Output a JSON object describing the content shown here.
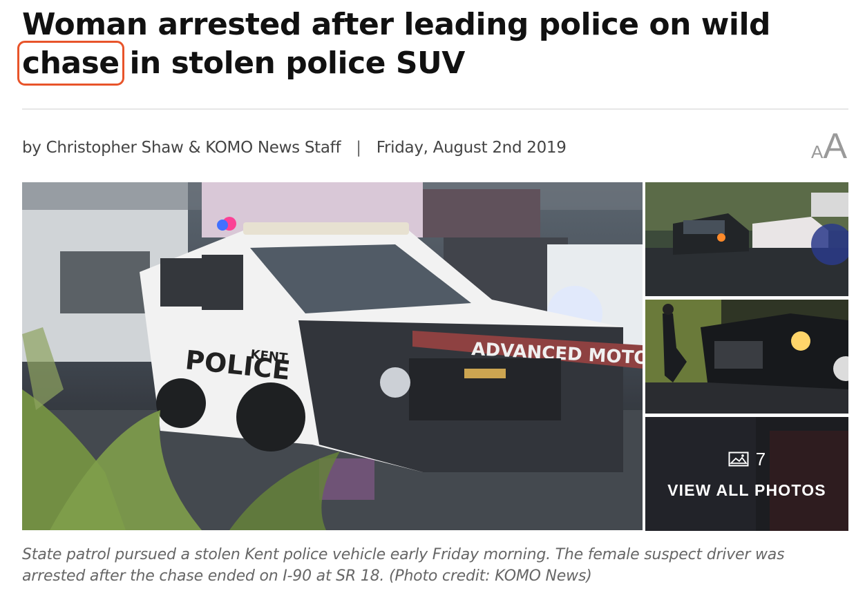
{
  "article": {
    "headline_before": "Woman arrested after leading police on wild ",
    "headline_highlight": "chase",
    "headline_after": " in stolen police SUV",
    "byline": "by Christopher Shaw & KOMO News Staff",
    "separator": "|",
    "date": "Friday, August 2nd 2019",
    "caption": "State patrol pursued a stolen Kent police vehicle early Friday morning. The female suspect driver was arrested after the chase ended on I-90 at SR 18. (Photo credit: KOMO News)"
  },
  "font_toggle": {
    "small": "A",
    "large": "A"
  },
  "gallery": {
    "photo_count": "7",
    "view_all_label": "VIEW ALL PHOTOS",
    "main_image_texts": {
      "police": "POLICE",
      "kent": "KENT",
      "banner": "ADVANCED MOTO"
    }
  },
  "colors": {
    "highlight_box": "#e8542a",
    "caption": "#666666",
    "byline": "#444444"
  }
}
